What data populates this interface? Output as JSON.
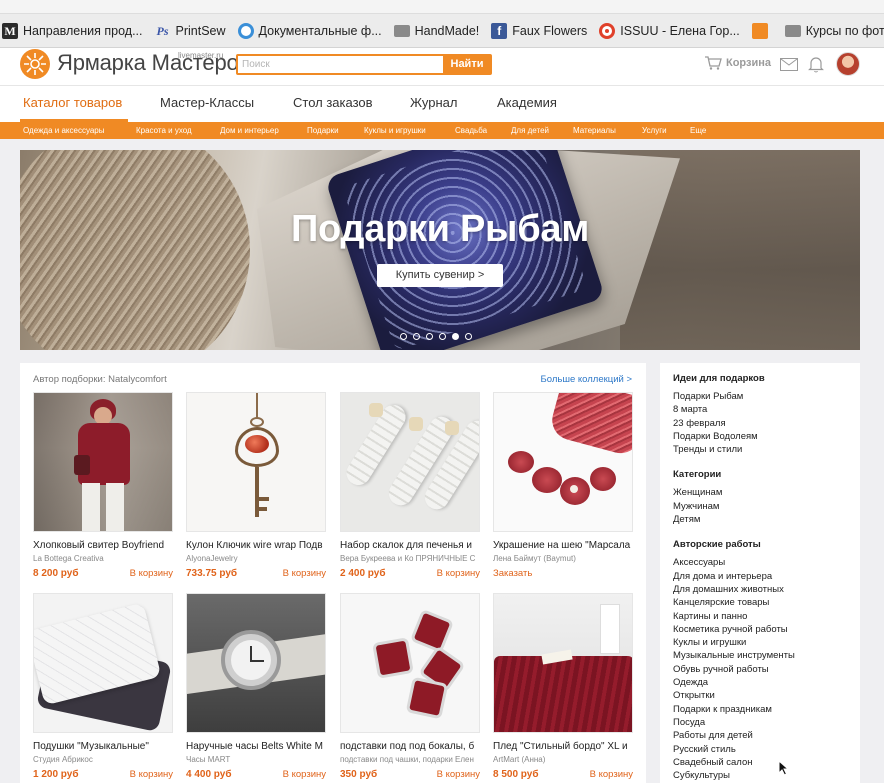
{
  "bookmarks": [
    {
      "label": "Направления прод...",
      "icon": "monogram-m-icon"
    },
    {
      "label": "PrintSew",
      "icon": "ps-icon"
    },
    {
      "label": "Документальные ф...",
      "icon": "circle-doc-icon"
    },
    {
      "label": "HandMade!",
      "icon": "folder-icon"
    },
    {
      "label": "Faux Flowers",
      "icon": "facebook-icon"
    },
    {
      "label": "ISSUU - Елена Гор...",
      "icon": "issuu-icon"
    },
    {
      "label": "",
      "icon": "sun-icon"
    },
    {
      "label": "Курсы по фотогра...",
      "icon": "folder-icon"
    }
  ],
  "header": {
    "logo_text": "Ярмарка Мастеров",
    "logo_sub": "livemaster.ru",
    "search_placeholder": "Поиск",
    "search_button": "Найти",
    "cart_label": "Корзина"
  },
  "nav": [
    "Каталог товаров",
    "Мастер-Классы",
    "Стол заказов",
    "Журнал",
    "Академия"
  ],
  "categories": [
    "Одежда и аксессуары",
    "Красота и уход",
    "Дом и интерьер",
    "Подарки",
    "Куклы и игрушки",
    "Свадьба",
    "Для детей",
    "Материалы",
    "Услуги",
    "Еще"
  ],
  "hero": {
    "title": "Подарки Рыбам",
    "button": "Купить сувенир >",
    "slide_count": 6,
    "active_slide": 5
  },
  "collection": {
    "author": "Автор подборки: Natalycomfort",
    "more": "Больше коллекций >",
    "products": [
      {
        "title": "Хлопковый свитер Boyfriend",
        "seller": "La Bottega Creativa",
        "price": "8 200 руб",
        "action": "В корзину"
      },
      {
        "title": "Кулон Ключик wire wrap Подв",
        "seller": "AlyonaJewelry",
        "price": "733.75 руб",
        "action": "В корзину"
      },
      {
        "title": "Набор скалок для печенья и",
        "seller": "Вера Букреева и Ко ПРЯНИЧНЫЕ С",
        "price": "2 400 руб",
        "action": "В корзину"
      },
      {
        "title": "Украшение на шею \"Марсала",
        "seller": "Лена Баймут (Baymut)",
        "price": "",
        "action": "Заказать"
      },
      {
        "title": "Подушки \"Музыкальные\"",
        "seller": "Студия Абрикос",
        "price": "1 200 руб",
        "action": "В корзину"
      },
      {
        "title": "Наручные часы Belts White M",
        "seller": "Часы MART",
        "price": "4 400 руб",
        "action": "В корзину"
      },
      {
        "title": "подставки под под бокалы, б",
        "seller": "подставки под чашки, подарки Елен",
        "price": "350 руб",
        "action": "В корзину"
      },
      {
        "title": "Плед \"Стильный бордо\" XL и",
        "seller": "ArtMart (Анна)",
        "price": "8 500 руб",
        "action": "В корзину"
      }
    ]
  },
  "sidebar": {
    "ideas_title": "Идеи для подарков",
    "ideas": [
      "Подарки Рыбам",
      "8 марта",
      "23 февраля",
      "Подарки Водолеям",
      "Тренды и стили"
    ],
    "categories_title": "Категории",
    "categories": [
      "Женщинам",
      "Мужчинам",
      "Детям"
    ],
    "works_title": "Авторские работы",
    "works": [
      "Аксессуары",
      "Для дома и интерьера",
      "Для домашних животных",
      "Канцелярские товары",
      "Картины и панно",
      "Косметика ручной работы",
      "Куклы и игрушки",
      "Музыкальные инструменты",
      "Обувь ручной работы",
      "Одежда",
      "Открытки",
      "Подарки к праздникам",
      "Посуда",
      "Работы для детей",
      "Русский стиль",
      "Свадебный салон",
      "Субкультуры"
    ]
  },
  "colors": {
    "accent": "#f08a24",
    "link": "#2d78c8",
    "price": "#e0631a"
  }
}
